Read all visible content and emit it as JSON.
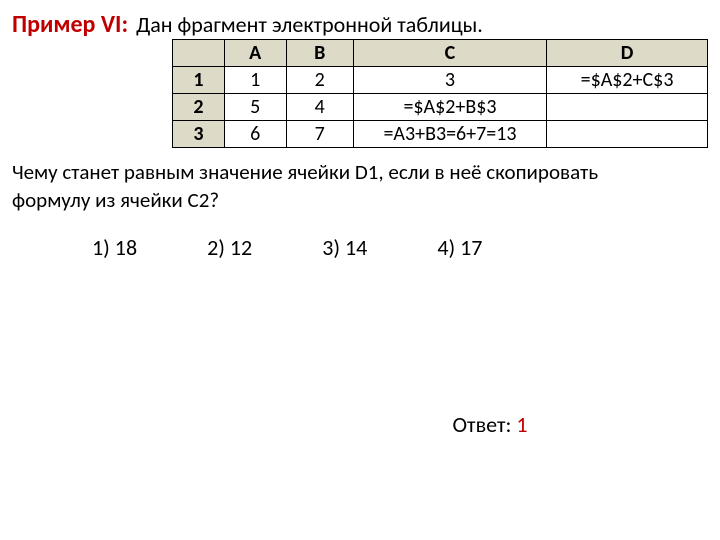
{
  "header": {
    "example_label": "Пример VI:",
    "given_text": "Дан фрагмент электронной таблицы."
  },
  "table": {
    "cols": {
      "a": "A",
      "b": "B",
      "c": "C",
      "d": "D"
    },
    "rows": [
      {
        "n": "1",
        "a": "1",
        "b": "2",
        "c": "3",
        "d": "=$A$2+C$3"
      },
      {
        "n": "2",
        "a": "5",
        "b": "4",
        "c": "=$A$2+B$3",
        "d": ""
      },
      {
        "n": "3",
        "a": "6",
        "b": "7",
        "c": "=A3+B3=6+7=13",
        "d": ""
      }
    ]
  },
  "question": {
    "line1": "Чему станет равным значение ячейки D1, если в неё скопировать",
    "line2": "формулу из ячейки C2?"
  },
  "options": {
    "o1": "1) 18",
    "o2": "2) 12",
    "o3": "3) 14",
    "o4": "4) 17"
  },
  "answer": {
    "label": "Ответ: ",
    "value": "1"
  }
}
